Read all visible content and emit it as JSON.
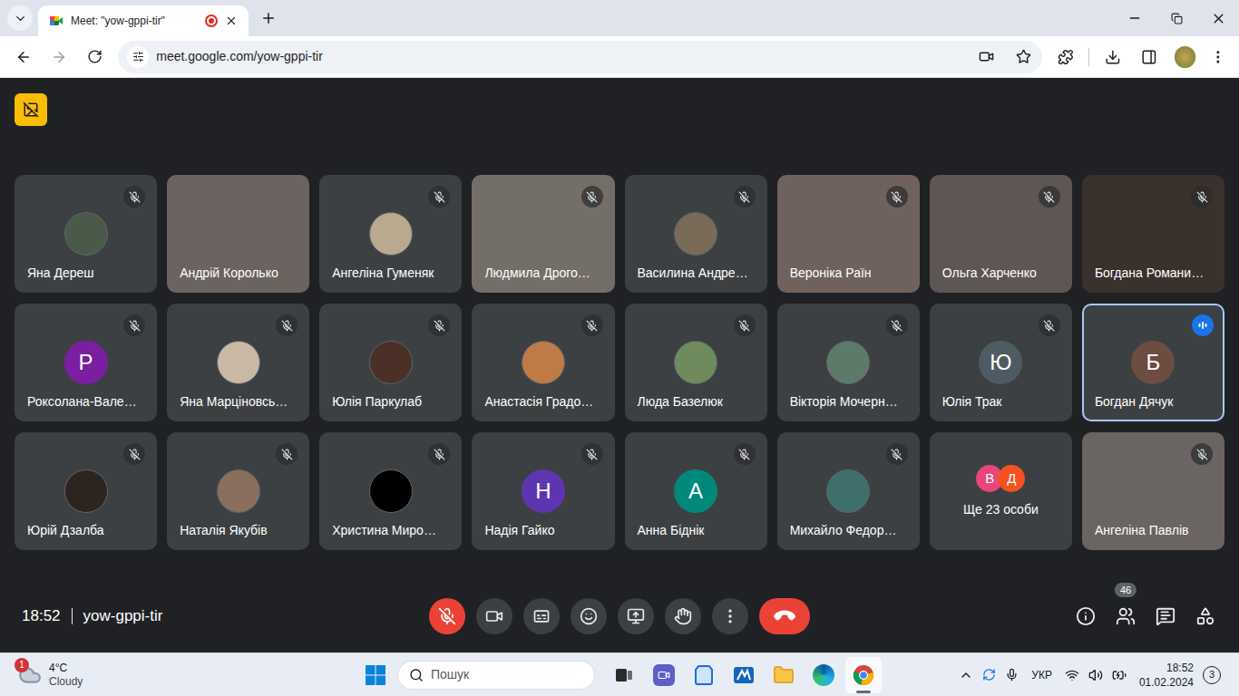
{
  "browser": {
    "tab": {
      "title": "Meet: \"yow-gppi-tir\"",
      "recording": true,
      "selected": true
    },
    "url": "meet.google.com/yow-gppi-tir"
  },
  "meeting": {
    "time": "18:52",
    "code": "yow-gppi-tir",
    "participant_count": "46"
  },
  "tiles": [
    {
      "name": "Яна Дереш",
      "kind": "photo",
      "muted": true,
      "speaking": false,
      "color": "#4a5a48"
    },
    {
      "name": "Андрій Королько",
      "kind": "video",
      "muted": false,
      "speaking": false,
      "color": "#6b6360"
    },
    {
      "name": "Ангеліна Гуменяк",
      "kind": "photo",
      "muted": true,
      "speaking": false,
      "color": "#b9a98f"
    },
    {
      "name": "Людмила Дрого…",
      "kind": "video",
      "muted": true,
      "speaking": false,
      "color": "#736e68"
    },
    {
      "name": "Василина Андре…",
      "kind": "photo",
      "muted": true,
      "speaking": false,
      "color": "#7a6a58"
    },
    {
      "name": "Вероніка Раїн",
      "kind": "video",
      "muted": true,
      "speaking": false,
      "color": "#6f625c"
    },
    {
      "name": "Ольга Харченко",
      "kind": "video",
      "muted": true,
      "speaking": false,
      "color": "#5e5654"
    },
    {
      "name": "Богдана Романи…",
      "kind": "video",
      "muted": true,
      "speaking": false,
      "color": "#3a302c"
    },
    {
      "name": "Роксолана-Вале…",
      "kind": "letter",
      "letter": "Р",
      "muted": true,
      "speaking": false,
      "color": "#7b1fa2"
    },
    {
      "name": "Яна Марціновсь…",
      "kind": "photo",
      "muted": true,
      "speaking": false,
      "color": "#c9b8a6"
    },
    {
      "name": "Юлія Паркулаб",
      "kind": "photo",
      "muted": true,
      "speaking": false,
      "color": "#4b3028"
    },
    {
      "name": "Анастасія Градо…",
      "kind": "photo",
      "muted": true,
      "speaking": false,
      "color": "#c07a45"
    },
    {
      "name": "Люда Базелюк",
      "kind": "photo",
      "muted": true,
      "speaking": false,
      "color": "#6f8a5c"
    },
    {
      "name": "Вікторія Мочерн…",
      "kind": "photo",
      "muted": true,
      "speaking": false,
      "color": "#5d7a68"
    },
    {
      "name": "Юлія Трак",
      "kind": "letter",
      "letter": "Ю",
      "muted": true,
      "speaking": false,
      "color": "#4f5b62"
    },
    {
      "name": "Богдан Дячук",
      "kind": "letter",
      "letter": "Б",
      "muted": false,
      "speaking": true,
      "color": "#6d4c41"
    },
    {
      "name": "Юрій Дзалба",
      "kind": "photo",
      "muted": true,
      "speaking": false,
      "color": "#2b241f"
    },
    {
      "name": "Наталія Якубів",
      "kind": "photo",
      "muted": true,
      "speaking": false,
      "color": "#8a6e5e"
    },
    {
      "name": "Христина Миро…",
      "kind": "photo",
      "muted": true,
      "speaking": false,
      "color": "#000000"
    },
    {
      "name": "Надія Гайко",
      "kind": "letter",
      "letter": "Н",
      "muted": true,
      "speaking": false,
      "color": "#5e35b1"
    },
    {
      "name": "Анна Біднік",
      "kind": "letter",
      "letter": "А",
      "muted": true,
      "speaking": false,
      "color": "#00897b"
    },
    {
      "name": "Михайло Федор…",
      "kind": "photo",
      "muted": true,
      "speaking": false,
      "color": "#3f6f6a"
    },
    {
      "name": "Ще 23 особи",
      "kind": "more",
      "muted": false,
      "speaking": false,
      "color": "#3c4043",
      "avatars": [
        {
          "letter": "В",
          "color": "#e8457c"
        },
        {
          "letter": "Д",
          "color": "#f4511e"
        }
      ]
    },
    {
      "name": "Ангеліна Павлів",
      "kind": "video",
      "muted": true,
      "speaking": false,
      "color": "#6a6462"
    }
  ],
  "controls": [
    {
      "kind": "mic",
      "on": false
    },
    {
      "kind": "camera",
      "on": true
    },
    {
      "kind": "captions",
      "on": false
    },
    {
      "kind": "emoji",
      "on": false
    },
    {
      "kind": "present",
      "on": false
    },
    {
      "kind": "hand",
      "on": false
    },
    {
      "kind": "more",
      "on": false
    },
    {
      "kind": "end",
      "on": false
    }
  ],
  "taskbar": {
    "weather": {
      "badge": "1",
      "temp": "4°C",
      "condition": "Cloudy"
    },
    "search": {
      "placeholder": "Пошук"
    },
    "apps": [
      {
        "kind": "taskview",
        "selected": false
      },
      {
        "kind": "meet",
        "selected": false
      },
      {
        "kind": "store",
        "selected": false
      },
      {
        "kind": "editor",
        "selected": false
      },
      {
        "kind": "explorer",
        "selected": false
      },
      {
        "kind": "edge",
        "selected": false
      },
      {
        "kind": "chrome",
        "selected": true
      }
    ],
    "tray": {
      "language": "УКР",
      "time": "18:52",
      "date": "01.02.2024",
      "notifications": "3"
    }
  }
}
